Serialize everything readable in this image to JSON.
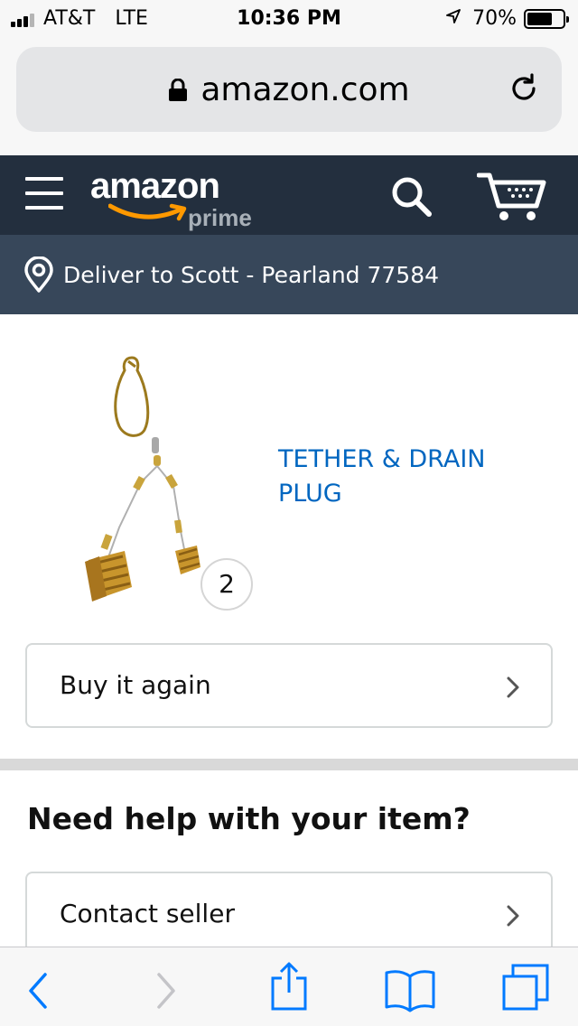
{
  "status_bar": {
    "carrier": "AT&T",
    "network": "LTE",
    "time": "10:36 PM",
    "battery": "70%",
    "battery_level": 0.7
  },
  "browser": {
    "url": "amazon.com"
  },
  "header": {
    "logo_text": "amazon",
    "logo_sub": "prime"
  },
  "delivery": {
    "text": "Deliver to Scott - Pearland 77584"
  },
  "product": {
    "title": "TETHER & DRAIN PLUG",
    "quantity": "2"
  },
  "actions": {
    "buy_again": "Buy it again"
  },
  "help": {
    "title": "Need help with your item?",
    "contact_seller": "Contact seller"
  },
  "colors": {
    "header_bg": "#232f3e",
    "deliver_bg": "#37475a",
    "link": "#0066c0",
    "smile": "#ff9900",
    "ios_blue": "#007aff"
  },
  "icons": {
    "menu": "hamburger-icon",
    "search": "search-icon",
    "cart": "cart-icon",
    "location": "location-pin-icon",
    "lock": "lock-icon",
    "reload": "reload-icon",
    "back": "back-icon",
    "forward": "forward-icon",
    "share": "share-icon",
    "bookmarks": "bookmarks-icon",
    "tabs": "tabs-icon"
  }
}
